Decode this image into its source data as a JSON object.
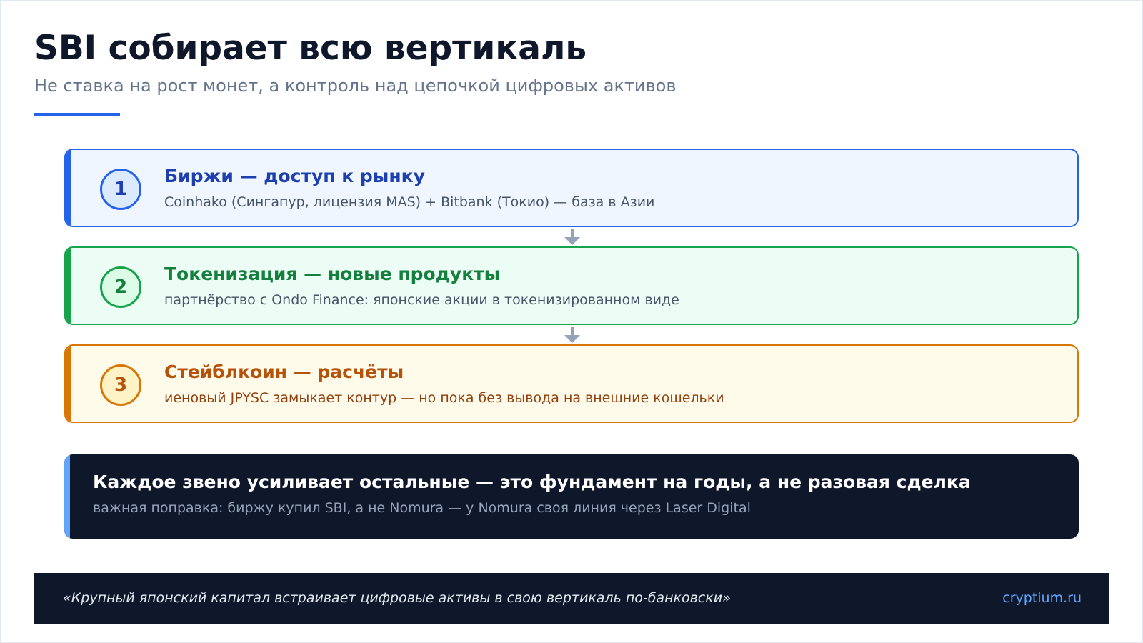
{
  "header": {
    "title": "SBI собирает всю вертикаль",
    "subtitle": "Не ставка на рост монет, а контроль над цепочкой цифровых активов"
  },
  "steps": [
    {
      "number": "1",
      "title": "Биржи — доступ к рынку",
      "description": "Coinhako (Сингапур, лицензия MAS) + Bitbank (Токио) — база в Азии",
      "colors": {
        "accent": "#2563eb",
        "title": "#1e40af",
        "background": "#eff6ff",
        "badge_bg": "#dbeafe",
        "description": "#475569"
      }
    },
    {
      "number": "2",
      "title": "Токенизация — новые продукты",
      "description": "партнёрство с Ondo Finance: японские акции в токенизированном виде",
      "colors": {
        "accent": "#16a34a",
        "title": "#15803d",
        "background": "#ecfdf5",
        "badge_bg": "#dcfce7",
        "description": "#475569"
      }
    },
    {
      "number": "3",
      "title": "Стейблкоин — расчёты",
      "description": "иеновый JPYSC замыкает контур — но пока без вывода на внешние кошельки",
      "colors": {
        "accent": "#d97706",
        "title": "#b45309",
        "background": "#fffbeb",
        "badge_bg": "#fef3c7",
        "description": "#92400e"
      }
    }
  ],
  "summary": {
    "title": "Каждое звено усиливает остальные — это фундамент на годы, а не разовая сделка",
    "note": "важная поправка: биржу купил SBI, а не Nomura — у Nomura своя линия через Laser Digital"
  },
  "footer": {
    "quote": "«Крупный японский капитал встраивает цифровые активы в свою вертикаль по-банковски»",
    "source": "cryptium.ru"
  },
  "colors": {
    "primary_accent": "#2563eb",
    "dark_panel": "#0f172a",
    "connector": "#94a3b8"
  }
}
